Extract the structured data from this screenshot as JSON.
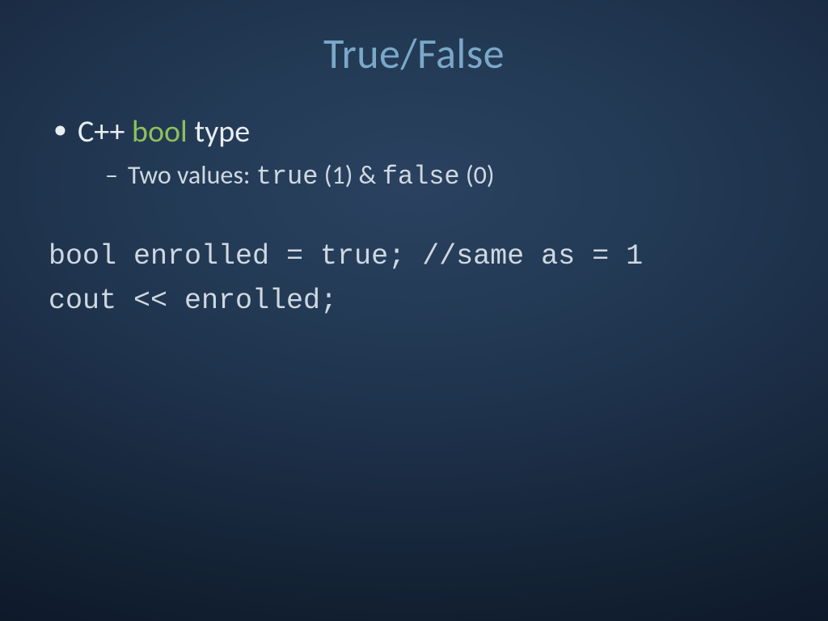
{
  "title": "True/False",
  "bullet1": {
    "pre": "C++ ",
    "kw": "bool",
    "post": " type"
  },
  "sub1": {
    "pre": "Two values: ",
    "m1": "true",
    "mid1": " (1) & ",
    "m2": "false",
    "mid2": " (0)"
  },
  "code": {
    "line1": "bool enrolled = true; //same as = 1",
    "line2": "cout << enrolled;"
  }
}
